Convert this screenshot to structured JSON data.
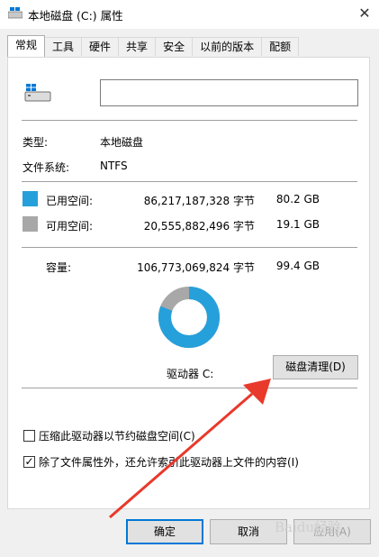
{
  "window": {
    "title": "本地磁盘 (C:) 属性",
    "close_glyph": "✕"
  },
  "tabs": [
    {
      "label": "常规",
      "active": true
    },
    {
      "label": "工具"
    },
    {
      "label": "硬件"
    },
    {
      "label": "共享"
    },
    {
      "label": "安全"
    },
    {
      "label": "以前的版本"
    },
    {
      "label": "配额"
    }
  ],
  "general": {
    "name_value": "",
    "type_label": "类型:",
    "type_value": "本地磁盘",
    "fs_label": "文件系统:",
    "fs_value": "NTFS",
    "used": {
      "label": "已用空间:",
      "bytes": "86,217,187,328 字节",
      "size": "80.2 GB",
      "color": "#26a0da"
    },
    "free": {
      "label": "可用空间:",
      "bytes": "20,555,882,496 字节",
      "size": "19.1 GB",
      "color": "#a8a8a8"
    },
    "capacity": {
      "label": "容量:",
      "bytes": "106,773,069,824 字节",
      "size": "99.4 GB"
    },
    "used_fraction": 0.8075,
    "drive_label": "驱动器 C:",
    "cleanup_button": "磁盘清理(D)"
  },
  "options": {
    "compress": {
      "label": "压缩此驱动器以节约磁盘空间(C)",
      "checked": false
    },
    "index": {
      "label": "除了文件属性外，还允许索引此驱动器上文件的内容(I)",
      "checked": true
    }
  },
  "buttons": {
    "ok": "确定",
    "cancel": "取消",
    "apply": "应用(A)"
  },
  "watermark": "Baidu经验",
  "colors": {
    "accent": "#0078d7",
    "used": "#26a0da",
    "free": "#a8a8a8",
    "arrow": "#e8392b"
  }
}
